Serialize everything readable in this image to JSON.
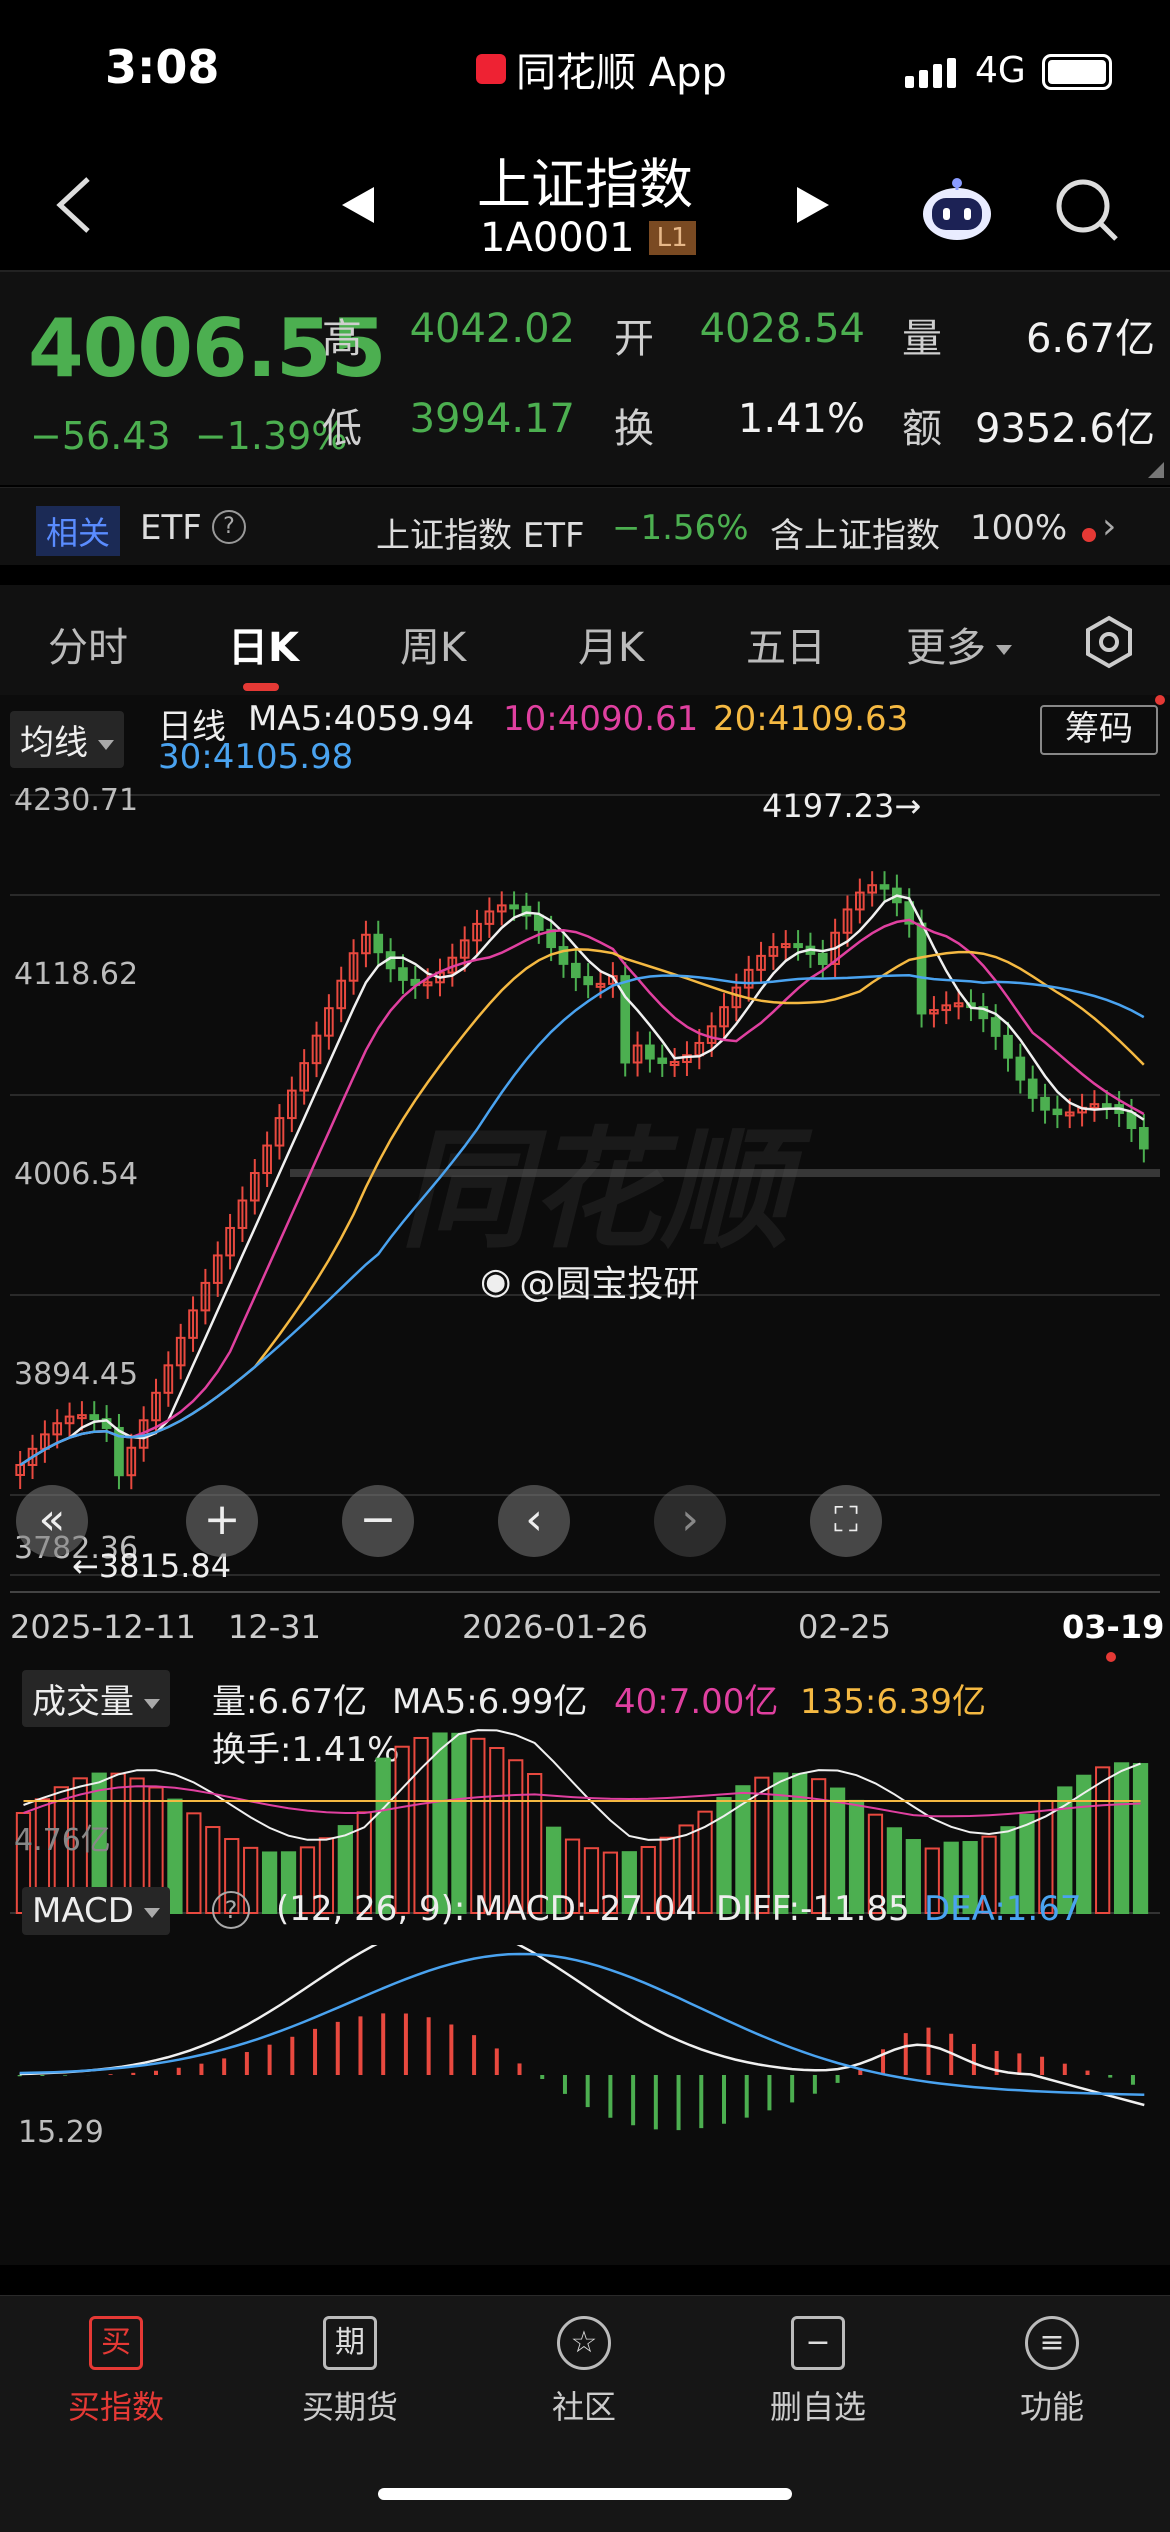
{
  "status_bar": {
    "time": "3:08",
    "app": "同花顺 App",
    "network": "4G"
  },
  "header": {
    "title": "上证指数",
    "code": "1A0001",
    "level": "L1"
  },
  "quote": {
    "price": "4006.55",
    "change": "−56.43",
    "change_pct": "−1.39%",
    "high_label": "高",
    "high": "4042.02",
    "open_label": "开",
    "open": "4028.54",
    "volume_label": "量",
    "volume": "6.67亿",
    "low_label": "低",
    "low": "3994.17",
    "turnover_label": "换",
    "turnover": "1.41%",
    "amount_label": "额",
    "amount": "9352.6亿"
  },
  "related": {
    "tag": "相关",
    "etf": "ETF",
    "help": "?",
    "etf_name": "上证指数 ETF",
    "etf_pct": "−1.56%",
    "hold_label": "含上证指数",
    "hold_pct": "100%",
    "arrow": "›"
  },
  "tabs": [
    "分时",
    "日K",
    "周K",
    "月K",
    "五日",
    "更多"
  ],
  "kline": {
    "ma_selector": "均线",
    "line_type": "日线",
    "ma5": "MA5:4059.94",
    "ma10": "10:4090.61",
    "ma20": "20:4109.63",
    "ma30": "30:4105.98",
    "chip_button": "筹码",
    "y_labels": [
      "4230.71",
      "4118.62",
      "4006.54",
      "3894.45",
      "3782.36"
    ],
    "high_marker": "4197.23→",
    "low_marker": "←3815.84",
    "watermark": "@圆宝投研",
    "x_labels": [
      "2025-12-11",
      "12-31",
      "2026-01-26",
      "02-25",
      "03-19"
    ],
    "colors": {
      "up": "#e8493f",
      "down": "#4caf50",
      "ma5": "#f0f0f0",
      "ma10": "#e040a0",
      "ma20": "#f5b942",
      "ma30": "#4aa3f0"
    }
  },
  "controls": [
    "«",
    "+",
    "−",
    "‹",
    "›",
    "⛶"
  ],
  "volume": {
    "selector": "成交量",
    "vol": "量:6.67亿",
    "ma5": "MA5:6.99亿",
    "ma40": "40:7.00亿",
    "ma135": "135:6.39亿",
    "turnover": "换手:1.41%",
    "axis_label": "4.76亿"
  },
  "macd": {
    "selector": "MACD",
    "help": "?",
    "params": "(12, 26, 9):",
    "macd": "MACD:-27.04",
    "diff": "DIFF:-11.85",
    "dea": "DEA:1.67",
    "axis_label": "15.29"
  },
  "bottom_nav": [
    {
      "icon": "买",
      "label": "买指数"
    },
    {
      "icon": "期",
      "label": "买期货"
    },
    {
      "icon": "☆",
      "label": "社区"
    },
    {
      "icon": "−",
      "label": "删自选"
    },
    {
      "icon": "≡",
      "label": "功能"
    }
  ]
}
